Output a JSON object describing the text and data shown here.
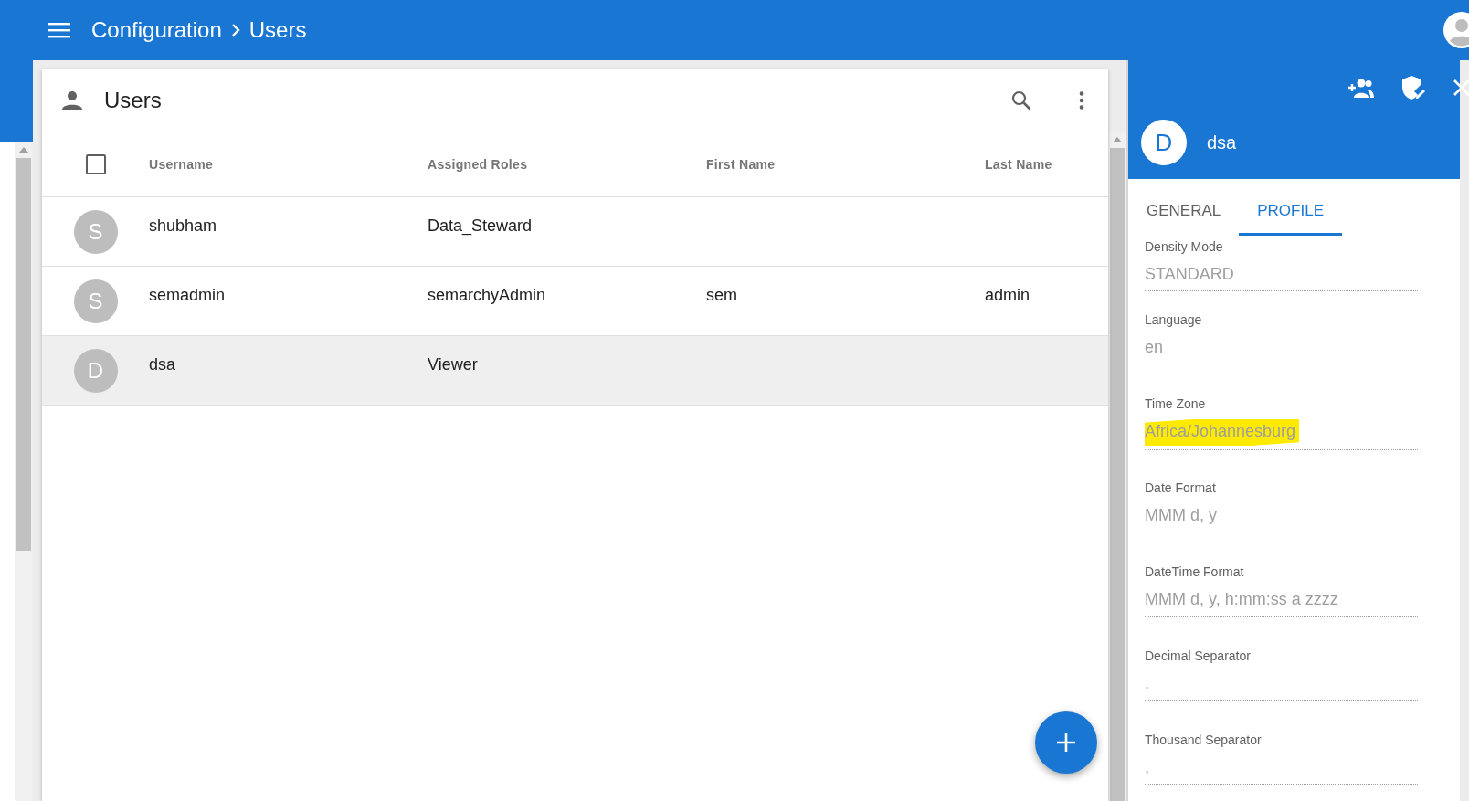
{
  "header": {
    "breadcrumb": [
      {
        "label": "Configuration"
      },
      {
        "label": "Users"
      }
    ]
  },
  "users_card": {
    "title": "Users",
    "select_all_checked": false,
    "columns": [
      "Username",
      "Assigned Roles",
      "First Name",
      "Last Name"
    ],
    "rows": [
      {
        "initial": "S",
        "username": "shubham",
        "roles": "Data_Steward",
        "selected": false
      },
      {
        "initial": "S",
        "username": "semadmin",
        "roles": "semarchyAdmin",
        "first_name": "sem",
        "last_name": "admin",
        "selected": false
      },
      {
        "initial": "D",
        "username": "dsa",
        "roles": "Viewer",
        "selected": true
      }
    ]
  },
  "detail_panel": {
    "avatar_initial": "D",
    "name": "dsa",
    "tabs": [
      {
        "label": "GENERAL",
        "selected": false
      },
      {
        "label": "PROFILE",
        "selected": true
      }
    ],
    "fields": [
      {
        "label": "Density Mode",
        "value": "STANDARD"
      },
      {
        "label": "Language",
        "value": "en"
      },
      {
        "label": "Time Zone",
        "value": "Africa/Johannesburg",
        "highlighted": true
      },
      {
        "label": "Date Format",
        "value": "MMM d, y"
      },
      {
        "label": "DateTime Format",
        "value": "MMM d, y, h:mm:ss a zzzz"
      },
      {
        "label": "Decimal Separator",
        "value": "."
      },
      {
        "label": "Thousand Separator",
        "value": ","
      }
    ]
  }
}
